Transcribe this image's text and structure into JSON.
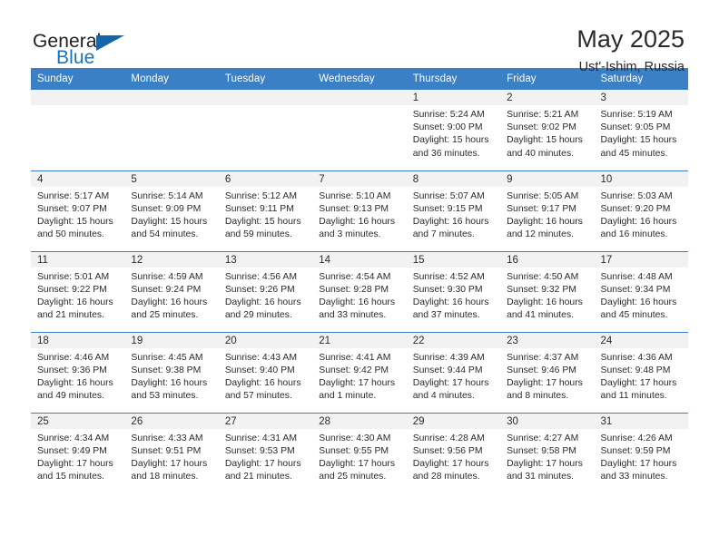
{
  "brand": {
    "name_part1": "General",
    "name_part2": "Blue",
    "triangle_icon": "triangle-logo-icon",
    "accent_color": "#1574bb"
  },
  "header": {
    "title": "May 2025",
    "subtitle": "Ust'-Ishim, Russia"
  },
  "theme": {
    "header_blue": "#3b7fc4",
    "daynum_band": "#f2f2f2",
    "text": "#2b2b2b"
  },
  "weekday_headers": [
    "Sunday",
    "Monday",
    "Tuesday",
    "Wednesday",
    "Thursday",
    "Friday",
    "Saturday"
  ],
  "labels": {
    "sunrise_prefix": "Sunrise:",
    "sunset_prefix": "Sunset:",
    "daylight_prefix": "Daylight:"
  },
  "weeks": [
    [
      {
        "day": "",
        "empty": true
      },
      {
        "day": "",
        "empty": true
      },
      {
        "day": "",
        "empty": true
      },
      {
        "day": "",
        "empty": true
      },
      {
        "day": "1",
        "sunrise": "Sunrise: 5:24 AM",
        "sunset": "Sunset: 9:00 PM",
        "daylight_line1": "Daylight: 15 hours",
        "daylight_line2": "and 36 minutes."
      },
      {
        "day": "2",
        "sunrise": "Sunrise: 5:21 AM",
        "sunset": "Sunset: 9:02 PM",
        "daylight_line1": "Daylight: 15 hours",
        "daylight_line2": "and 40 minutes."
      },
      {
        "day": "3",
        "sunrise": "Sunrise: 5:19 AM",
        "sunset": "Sunset: 9:05 PM",
        "daylight_line1": "Daylight: 15 hours",
        "daylight_line2": "and 45 minutes."
      }
    ],
    [
      {
        "day": "4",
        "sunrise": "Sunrise: 5:17 AM",
        "sunset": "Sunset: 9:07 PM",
        "daylight_line1": "Daylight: 15 hours",
        "daylight_line2": "and 50 minutes."
      },
      {
        "day": "5",
        "sunrise": "Sunrise: 5:14 AM",
        "sunset": "Sunset: 9:09 PM",
        "daylight_line1": "Daylight: 15 hours",
        "daylight_line2": "and 54 minutes."
      },
      {
        "day": "6",
        "sunrise": "Sunrise: 5:12 AM",
        "sunset": "Sunset: 9:11 PM",
        "daylight_line1": "Daylight: 15 hours",
        "daylight_line2": "and 59 minutes."
      },
      {
        "day": "7",
        "sunrise": "Sunrise: 5:10 AM",
        "sunset": "Sunset: 9:13 PM",
        "daylight_line1": "Daylight: 16 hours",
        "daylight_line2": "and 3 minutes."
      },
      {
        "day": "8",
        "sunrise": "Sunrise: 5:07 AM",
        "sunset": "Sunset: 9:15 PM",
        "daylight_line1": "Daylight: 16 hours",
        "daylight_line2": "and 7 minutes."
      },
      {
        "day": "9",
        "sunrise": "Sunrise: 5:05 AM",
        "sunset": "Sunset: 9:17 PM",
        "daylight_line1": "Daylight: 16 hours",
        "daylight_line2": "and 12 minutes."
      },
      {
        "day": "10",
        "sunrise": "Sunrise: 5:03 AM",
        "sunset": "Sunset: 9:20 PM",
        "daylight_line1": "Daylight: 16 hours",
        "daylight_line2": "and 16 minutes."
      }
    ],
    [
      {
        "day": "11",
        "sunrise": "Sunrise: 5:01 AM",
        "sunset": "Sunset: 9:22 PM",
        "daylight_line1": "Daylight: 16 hours",
        "daylight_line2": "and 21 minutes."
      },
      {
        "day": "12",
        "sunrise": "Sunrise: 4:59 AM",
        "sunset": "Sunset: 9:24 PM",
        "daylight_line1": "Daylight: 16 hours",
        "daylight_line2": "and 25 minutes."
      },
      {
        "day": "13",
        "sunrise": "Sunrise: 4:56 AM",
        "sunset": "Sunset: 9:26 PM",
        "daylight_line1": "Daylight: 16 hours",
        "daylight_line2": "and 29 minutes."
      },
      {
        "day": "14",
        "sunrise": "Sunrise: 4:54 AM",
        "sunset": "Sunset: 9:28 PM",
        "daylight_line1": "Daylight: 16 hours",
        "daylight_line2": "and 33 minutes."
      },
      {
        "day": "15",
        "sunrise": "Sunrise: 4:52 AM",
        "sunset": "Sunset: 9:30 PM",
        "daylight_line1": "Daylight: 16 hours",
        "daylight_line2": "and 37 minutes."
      },
      {
        "day": "16",
        "sunrise": "Sunrise: 4:50 AM",
        "sunset": "Sunset: 9:32 PM",
        "daylight_line1": "Daylight: 16 hours",
        "daylight_line2": "and 41 minutes."
      },
      {
        "day": "17",
        "sunrise": "Sunrise: 4:48 AM",
        "sunset": "Sunset: 9:34 PM",
        "daylight_line1": "Daylight: 16 hours",
        "daylight_line2": "and 45 minutes."
      }
    ],
    [
      {
        "day": "18",
        "sunrise": "Sunrise: 4:46 AM",
        "sunset": "Sunset: 9:36 PM",
        "daylight_line1": "Daylight: 16 hours",
        "daylight_line2": "and 49 minutes."
      },
      {
        "day": "19",
        "sunrise": "Sunrise: 4:45 AM",
        "sunset": "Sunset: 9:38 PM",
        "daylight_line1": "Daylight: 16 hours",
        "daylight_line2": "and 53 minutes."
      },
      {
        "day": "20",
        "sunrise": "Sunrise: 4:43 AM",
        "sunset": "Sunset: 9:40 PM",
        "daylight_line1": "Daylight: 16 hours",
        "daylight_line2": "and 57 minutes."
      },
      {
        "day": "21",
        "sunrise": "Sunrise: 4:41 AM",
        "sunset": "Sunset: 9:42 PM",
        "daylight_line1": "Daylight: 17 hours",
        "daylight_line2": "and 1 minute."
      },
      {
        "day": "22",
        "sunrise": "Sunrise: 4:39 AM",
        "sunset": "Sunset: 9:44 PM",
        "daylight_line1": "Daylight: 17 hours",
        "daylight_line2": "and 4 minutes."
      },
      {
        "day": "23",
        "sunrise": "Sunrise: 4:37 AM",
        "sunset": "Sunset: 9:46 PM",
        "daylight_line1": "Daylight: 17 hours",
        "daylight_line2": "and 8 minutes."
      },
      {
        "day": "24",
        "sunrise": "Sunrise: 4:36 AM",
        "sunset": "Sunset: 9:48 PM",
        "daylight_line1": "Daylight: 17 hours",
        "daylight_line2": "and 11 minutes."
      }
    ],
    [
      {
        "day": "25",
        "sunrise": "Sunrise: 4:34 AM",
        "sunset": "Sunset: 9:49 PM",
        "daylight_line1": "Daylight: 17 hours",
        "daylight_line2": "and 15 minutes."
      },
      {
        "day": "26",
        "sunrise": "Sunrise: 4:33 AM",
        "sunset": "Sunset: 9:51 PM",
        "daylight_line1": "Daylight: 17 hours",
        "daylight_line2": "and 18 minutes."
      },
      {
        "day": "27",
        "sunrise": "Sunrise: 4:31 AM",
        "sunset": "Sunset: 9:53 PM",
        "daylight_line1": "Daylight: 17 hours",
        "daylight_line2": "and 21 minutes."
      },
      {
        "day": "28",
        "sunrise": "Sunrise: 4:30 AM",
        "sunset": "Sunset: 9:55 PM",
        "daylight_line1": "Daylight: 17 hours",
        "daylight_line2": "and 25 minutes."
      },
      {
        "day": "29",
        "sunrise": "Sunrise: 4:28 AM",
        "sunset": "Sunset: 9:56 PM",
        "daylight_line1": "Daylight: 17 hours",
        "daylight_line2": "and 28 minutes."
      },
      {
        "day": "30",
        "sunrise": "Sunrise: 4:27 AM",
        "sunset": "Sunset: 9:58 PM",
        "daylight_line1": "Daylight: 17 hours",
        "daylight_line2": "and 31 minutes."
      },
      {
        "day": "31",
        "sunrise": "Sunrise: 4:26 AM",
        "sunset": "Sunset: 9:59 PM",
        "daylight_line1": "Daylight: 17 hours",
        "daylight_line2": "and 33 minutes."
      }
    ]
  ]
}
